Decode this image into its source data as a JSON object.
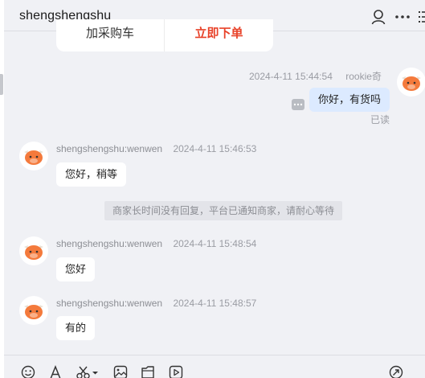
{
  "header": {
    "title": "shengshengshu",
    "icons": [
      "user-icon",
      "more-icon",
      "list-icon"
    ]
  },
  "product_card": {
    "cart_label": "加采购车",
    "buy_label": "立即下单"
  },
  "messages": [
    {
      "sender": "rookie奇",
      "time": "2024-4-11 15:44:54",
      "text": "你好，有货吗",
      "mine": true,
      "status": "已读"
    },
    {
      "sender": "shengshengshu:wenwen",
      "time": "2024-4-11 15:46:53",
      "text": "您好，稍等",
      "mine": false
    },
    {
      "sender": "shengshengshu:wenwen",
      "time": "2024-4-11 15:48:54",
      "text": "您好",
      "mine": false
    },
    {
      "sender": "shengshengshu:wenwen",
      "time": "2024-4-11 15:48:57",
      "text": "有的",
      "mine": false
    }
  ],
  "system_notice": "商家长时间没有回复，平台已通知商家，请耐心等待",
  "toolbar": {
    "icons": [
      "emoji-icon",
      "font-icon",
      "scissors-icon",
      "image-icon",
      "file-icon",
      "video-icon",
      "send-icon"
    ]
  },
  "colors": {
    "background": "#f0f1f5",
    "mine_bubble": "#dceaff",
    "buy_accent": "#e8432a",
    "avatar_accent": "#f47a3c"
  }
}
